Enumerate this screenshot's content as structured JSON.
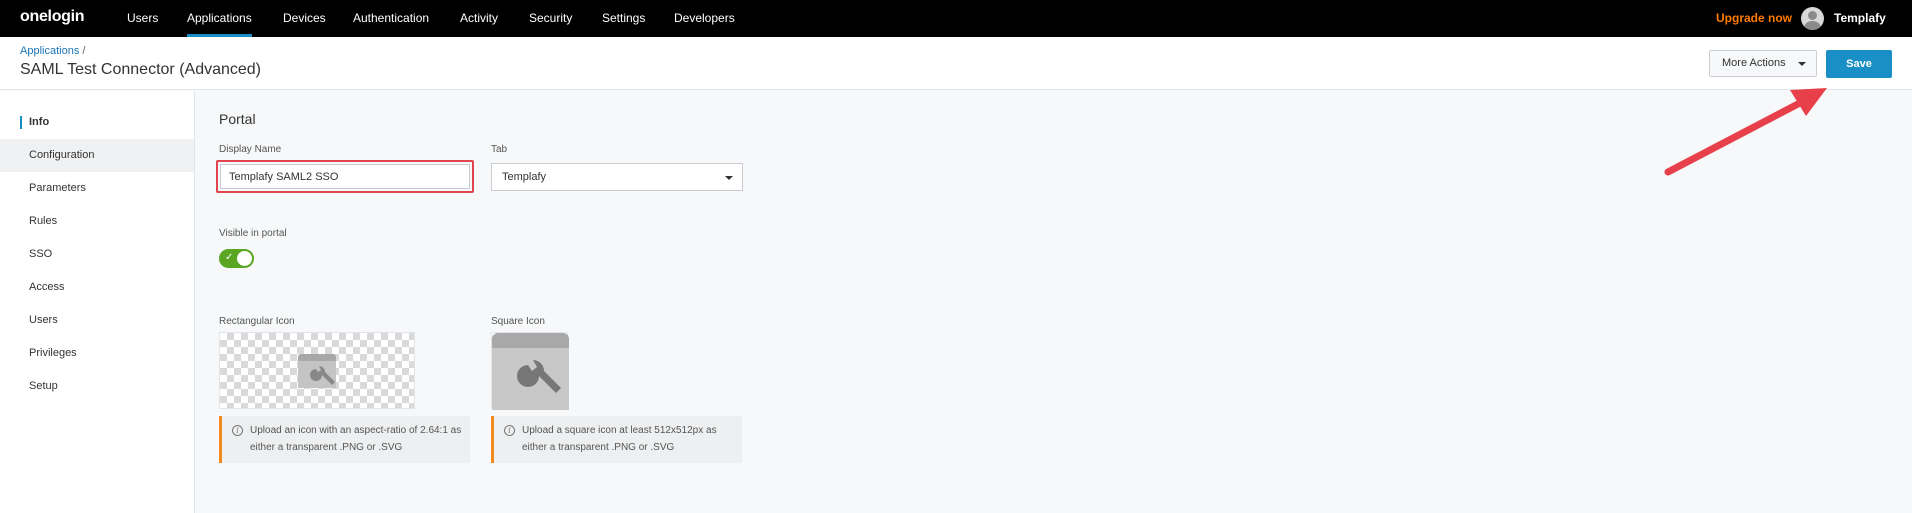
{
  "nav": {
    "logo": "onelogin",
    "items": [
      "Users",
      "Applications",
      "Devices",
      "Authentication",
      "Activity",
      "Security",
      "Settings",
      "Developers"
    ],
    "upgrade": "Upgrade now",
    "user": "Templafy"
  },
  "header": {
    "breadcrumb": "Applications",
    "breadcrumb_sep": "/",
    "title": "SAML Test Connector (Advanced)",
    "more_actions": "More Actions",
    "save": "Save"
  },
  "sidebar": {
    "items": [
      "Info",
      "Configuration",
      "Parameters",
      "Rules",
      "SSO",
      "Access",
      "Users",
      "Privileges",
      "Setup"
    ],
    "active": "Info"
  },
  "portal": {
    "title": "Portal",
    "display_name_label": "Display Name",
    "display_name_value": "Templafy SAML2 SSO",
    "tab_label": "Tab",
    "tab_value": "Templafy",
    "visible_label": "Visible in portal",
    "visible": true,
    "rect_icon_label": "Rectangular Icon",
    "rect_icon_info_1": "Upload an icon with an aspect-ratio of 2.64:1 as",
    "rect_icon_info_2": "either a transparent .PNG or .SVG",
    "square_icon_label": "Square Icon",
    "square_icon_info_1": "Upload a square icon at least 512x512px as",
    "square_icon_info_2": "either a transparent .PNG or .SVG"
  },
  "colors": {
    "accent": "#1a8fc6",
    "upgrade": "#ff7a00",
    "toggle_on": "#5aa622",
    "highlight": "#e0444d"
  }
}
